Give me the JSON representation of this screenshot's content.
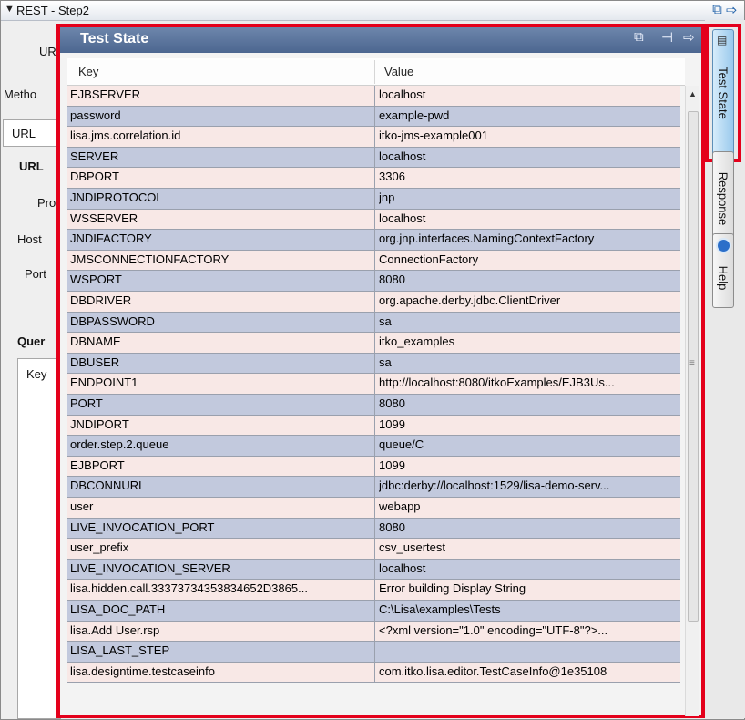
{
  "window": {
    "title": "REST - Step2"
  },
  "background": {
    "labels": [
      "UR",
      "Metho",
      "URL",
      "URL",
      "Pro",
      "Host",
      "Port",
      "Quer",
      "Key"
    ]
  },
  "panel": {
    "title": "Test State",
    "columns": {
      "key": "Key",
      "value": "Value"
    },
    "rows": [
      {
        "key": "EJBSERVER",
        "value": "localhost"
      },
      {
        "key": "password",
        "value": "example-pwd"
      },
      {
        "key": "lisa.jms.correlation.id",
        "value": "itko-jms-example001"
      },
      {
        "key": "SERVER",
        "value": "localhost"
      },
      {
        "key": "DBPORT",
        "value": "3306"
      },
      {
        "key": "JNDIPROTOCOL",
        "value": "jnp"
      },
      {
        "key": "WSSERVER",
        "value": "localhost"
      },
      {
        "key": "JNDIFACTORY",
        "value": "org.jnp.interfaces.NamingContextFactory"
      },
      {
        "key": "JMSCONNECTIONFACTORY",
        "value": "ConnectionFactory"
      },
      {
        "key": "WSPORT",
        "value": "8080"
      },
      {
        "key": "DBDRIVER",
        "value": "org.apache.derby.jdbc.ClientDriver"
      },
      {
        "key": "DBPASSWORD",
        "value": "sa"
      },
      {
        "key": "DBNAME",
        "value": "itko_examples"
      },
      {
        "key": "DBUSER",
        "value": "sa"
      },
      {
        "key": "ENDPOINT1",
        "value": "http://localhost:8080/itkoExamples/EJB3Us..."
      },
      {
        "key": "PORT",
        "value": "8080"
      },
      {
        "key": "JNDIPORT",
        "value": "1099"
      },
      {
        "key": "order.step.2.queue",
        "value": "queue/C"
      },
      {
        "key": "EJBPORT",
        "value": "1099"
      },
      {
        "key": "DBCONNURL",
        "value": "jdbc:derby://localhost:1529/lisa-demo-serv..."
      },
      {
        "key": "user",
        "value": "webapp"
      },
      {
        "key": "LIVE_INVOCATION_PORT",
        "value": "8080"
      },
      {
        "key": "user_prefix",
        "value": "csv_usertest"
      },
      {
        "key": "LIVE_INVOCATION_SERVER",
        "value": "localhost"
      },
      {
        "key": "lisa.hidden.call.33373734353834652D3865...",
        "value": "Error building Display String"
      },
      {
        "key": "LISA_DOC_PATH",
        "value": "C:\\Lisa\\examples\\Tests"
      },
      {
        "key": "lisa.Add User.rsp",
        "value": "<?xml version=\"1.0\" encoding=\"UTF-8\"?>..."
      },
      {
        "key": "LISA_LAST_STEP",
        "value": ""
      },
      {
        "key": "lisa.designtime.testcaseinfo",
        "value": "com.itko.lisa.editor.TestCaseInfo@1e35108"
      }
    ]
  },
  "side_tabs": [
    {
      "id": "test-state",
      "label": "Test State",
      "active": true
    },
    {
      "id": "response",
      "label": "Response",
      "active": false
    },
    {
      "id": "help",
      "label": "Help",
      "active": false
    }
  ],
  "colors": {
    "row_even": "#f8e8e6",
    "row_odd": "#c2c9dd",
    "highlight": "#e4001b",
    "panel_header": "#5670a0"
  }
}
